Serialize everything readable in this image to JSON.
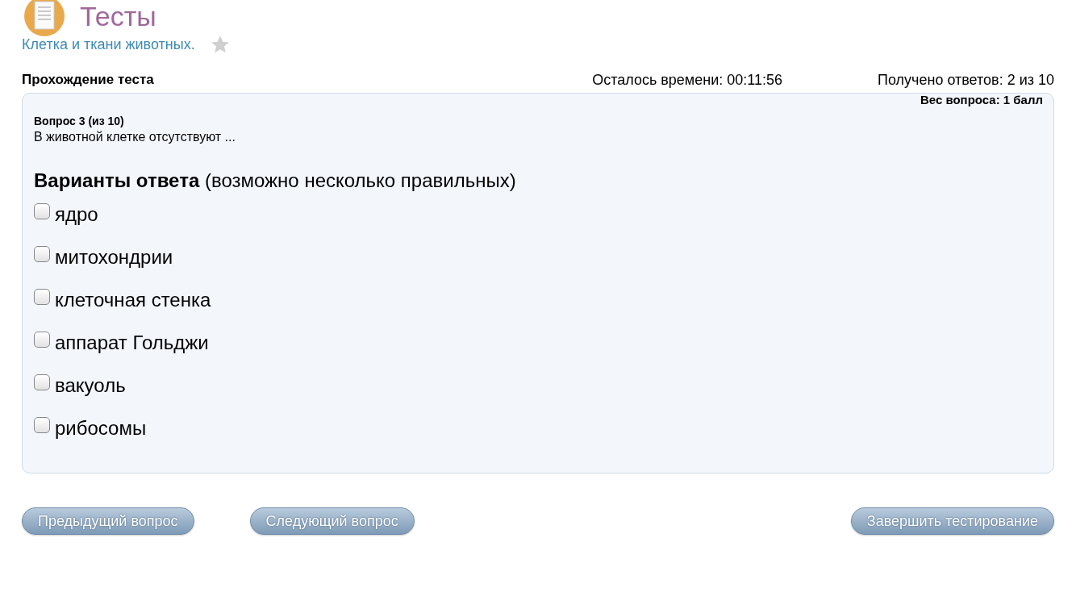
{
  "header": {
    "title": "Тесты"
  },
  "test_link": {
    "label": "Клетка и ткани животных.",
    "favorite": false
  },
  "status": {
    "heading": "Прохождение теста",
    "time_left": "Осталось времени: 00:11:56",
    "answers": "Получено ответов: 2 из 10"
  },
  "question": {
    "weight": "Вес вопроса: 1 балл",
    "number": "Вопрос 3 (из 10)",
    "text": "В животной клетке отсутствуют ...",
    "options_heading": "**Варианты ответа** (возможно несколько правильных)",
    "options": [
      {
        "label": "ядро",
        "checked": false
      },
      {
        "label": "митохондрии",
        "checked": false
      },
      {
        "label": "клеточная стенка",
        "checked": false
      },
      {
        "label": "аппарат Гольджи",
        "checked": false
      },
      {
        "label": "вакуоль",
        "checked": false
      },
      {
        "label": "рибосомы",
        "checked": false
      }
    ]
  },
  "nav_buttons": [
    "Предыдущий вопрос",
    "Следующий вопрос"
  ],
  "finish_button": "Завершить тестирование"
}
